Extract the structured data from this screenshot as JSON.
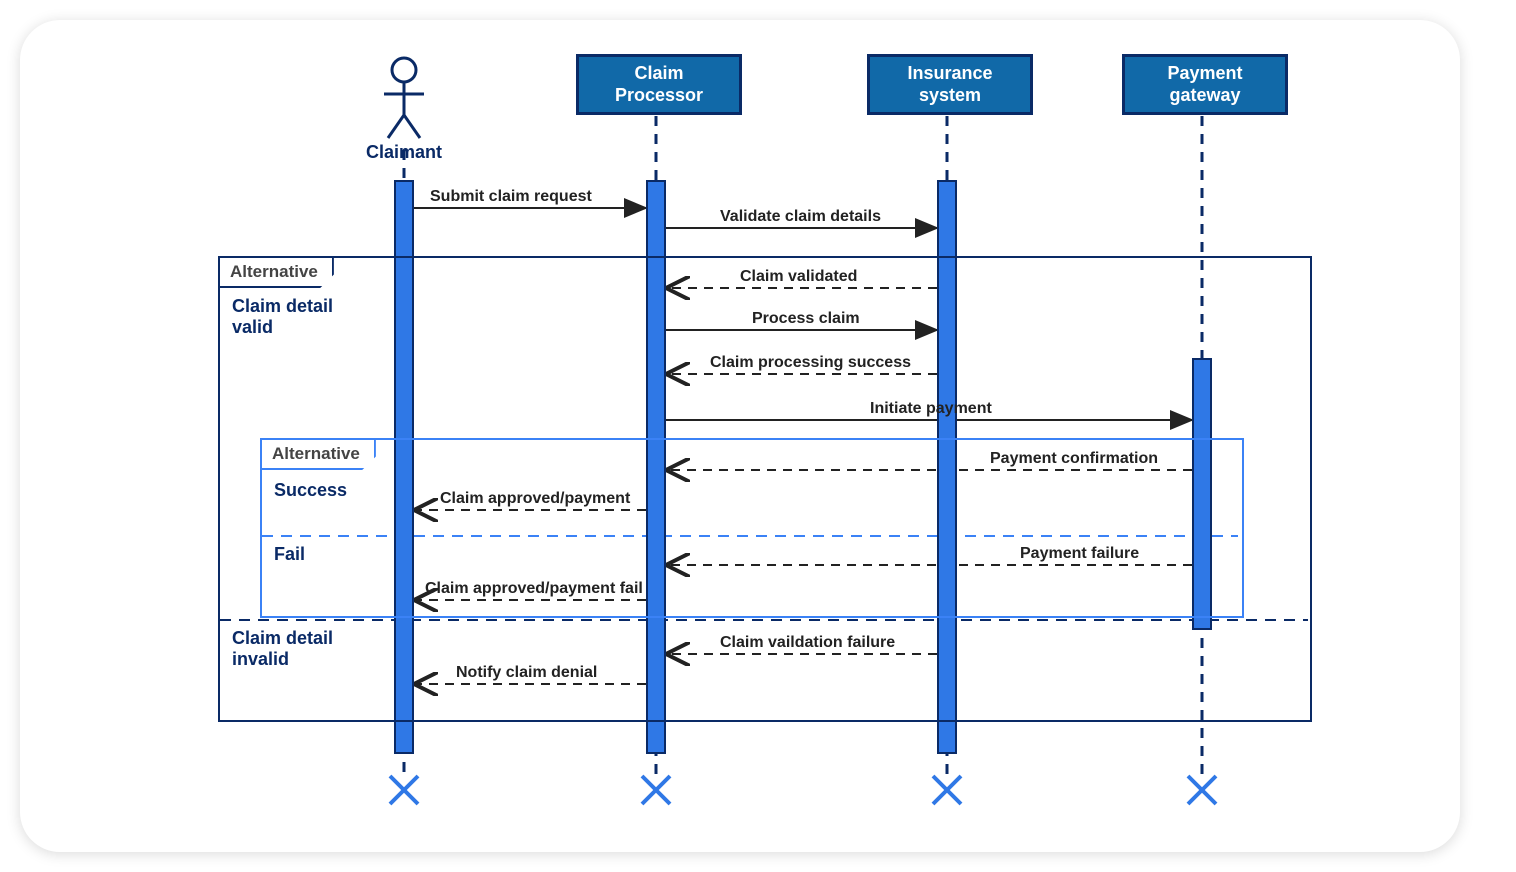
{
  "participants": {
    "claimant": "Claimant",
    "processor": "Claim\nProcessor",
    "insurance": "Insurance\nsystem",
    "gateway": "Payment\ngateway"
  },
  "messages": {
    "submit": "Submit claim request",
    "validate": "Validate claim details",
    "validated": "Claim validated",
    "process": "Process claim",
    "procSuccess": "Claim processing success",
    "initiate": "Initiate payment",
    "payConfirm": "Payment confirmation",
    "approvedPay": "Claim approved/payment",
    "payFail": "Payment failure",
    "approvedFail": "Claim approved/payment fail",
    "validationFail": "Claim vaildation failure",
    "notifyDenial": "Notify claim denial"
  },
  "fragments": {
    "alt1": {
      "label": "Alternative",
      "cond1": "Claim detail\nvalid",
      "cond2": "Claim detail\ninvalid"
    },
    "alt2": {
      "label": "Alternative",
      "cond1": "Success",
      "cond2": "Fail"
    }
  }
}
